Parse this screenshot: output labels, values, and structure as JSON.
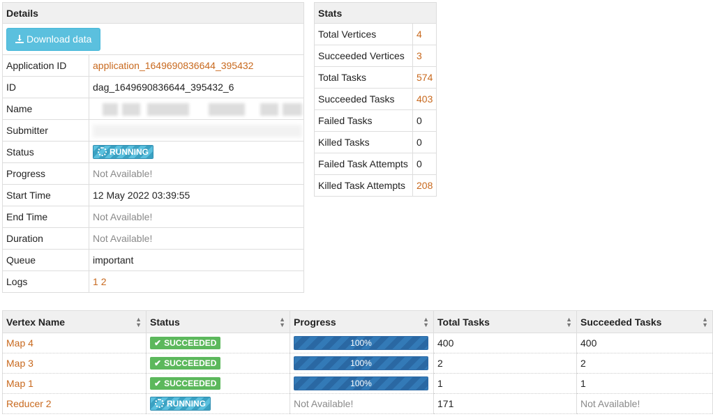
{
  "details": {
    "title": "Details",
    "download_label": "Download data",
    "rows": [
      {
        "key": "Application ID",
        "value": "application_1649690836644_395432"
      },
      {
        "key": "ID",
        "value": "dag_1649690836644_395432_6"
      },
      {
        "key": "Name",
        "value": ""
      },
      {
        "key": "Submitter",
        "value": ""
      },
      {
        "key": "Status",
        "value": "RUNNING"
      },
      {
        "key": "Progress",
        "value": "Not Available!"
      },
      {
        "key": "Start Time",
        "value": "12 May 2022 03:39:55"
      },
      {
        "key": "End Time",
        "value": "Not Available!"
      },
      {
        "key": "Duration",
        "value": "Not Available!"
      },
      {
        "key": "Queue",
        "value": "important"
      },
      {
        "key": "Logs",
        "value1": "1",
        "value2": "2"
      }
    ]
  },
  "stats": {
    "title": "Stats",
    "rows": [
      {
        "key": "Total Vertices",
        "value": "4"
      },
      {
        "key": "Succeeded Vertices",
        "value": "3"
      },
      {
        "key": "Total Tasks",
        "value": "574"
      },
      {
        "key": "Succeeded Tasks",
        "value": "403"
      },
      {
        "key": "Failed Tasks",
        "value": "0"
      },
      {
        "key": "Killed Tasks",
        "value": "0"
      },
      {
        "key": "Failed Task Attempts",
        "value": "0"
      },
      {
        "key": "Killed Task Attempts",
        "value": "208"
      }
    ]
  },
  "vertices": {
    "headers": [
      "Vertex Name",
      "Status",
      "Progress",
      "Total Tasks",
      "Succeeded Tasks"
    ],
    "rows": [
      {
        "name": "Map 4",
        "status": "SUCCEEDED",
        "progress": "100%",
        "progress_fraction": 1.0,
        "total": "400",
        "succeeded": "400"
      },
      {
        "name": "Map 3",
        "status": "SUCCEEDED",
        "progress": "100%",
        "progress_fraction": 1.0,
        "total": "2",
        "succeeded": "2"
      },
      {
        "name": "Map 1",
        "status": "SUCCEEDED",
        "progress": "100%",
        "progress_fraction": 1.0,
        "total": "1",
        "succeeded": "1"
      },
      {
        "name": "Reducer 2",
        "status": "RUNNING",
        "progress": "Not Available!",
        "total": "171",
        "succeeded": "Not Available!"
      }
    ]
  },
  "colors": {
    "link": "#c8691e",
    "running": "#5bc0de",
    "succeeded": "#5cb85c",
    "progress": "#337ab7"
  }
}
